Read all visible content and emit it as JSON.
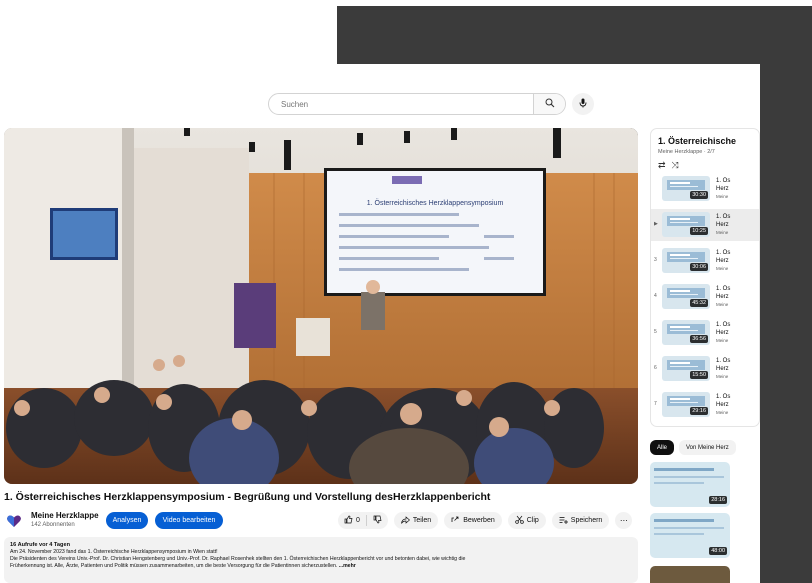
{
  "search": {
    "placeholder": "Suchen"
  },
  "video": {
    "slide_title": "1. Österreichisches Herzklappensymposium",
    "title": "1. Österreichisches Herzklappensymposium - Begrüßung und Vorstellung desHerzklappenbericht"
  },
  "channel": {
    "name": "Meine Herzklappe",
    "subscribers": "142 Abonnenten",
    "analyze_label": "Analysen",
    "edit_label": "Video bearbeiten"
  },
  "actions": {
    "like_count": "0",
    "share_label": "Teilen",
    "promote_label": "Bewerben",
    "clip_label": "Clip",
    "save_label": "Speichern"
  },
  "description": {
    "meta": "16 Aufrufe  vor 4 Tagen",
    "line1": "Am 24. November 2023 fand das 1. Österreichische Herzklappensymposium in Wien statt!",
    "line2": "Die Präsidenten des Vereins Univ.-Prof. Dr. Christian Hengstenberg und Univ.-Prof. Dr. Raphael Rosenhek stellten den 1. Österreichischen Herzklappenbericht vor und betonten dabei, wie wichtig die",
    "line3": "Früherkennung ist. Alle, Ärzte, Patienten und Politik müssen zusammenarbeiten, um die beste Versorgung für die Patientinnen sicherzustellen.",
    "more": "...mehr"
  },
  "playlist": {
    "title": "1. Österreichische",
    "subtitle": "Meine Herzklappe · 2/7",
    "items": [
      {
        "index": "",
        "title": "1. Ös",
        "title2": "Herz",
        "channel": "Meine",
        "duration": "30:30"
      },
      {
        "index": "▶",
        "title": "1. Ös",
        "title2": "Herz",
        "channel": "Meine",
        "duration": "10:25"
      },
      {
        "index": "3",
        "title": "1. Ös",
        "title2": "Herz",
        "channel": "Meine",
        "duration": "30:06"
      },
      {
        "index": "4",
        "title": "1. Ös",
        "title2": "Herz",
        "channel": "Meine",
        "duration": "45:32"
      },
      {
        "index": "5",
        "title": "1. Ös",
        "title2": "Herz",
        "channel": "Meine",
        "duration": "36:56"
      },
      {
        "index": "6",
        "title": "1. Ös",
        "title2": "Herz",
        "channel": "Meine",
        "duration": "15:50"
      },
      {
        "index": "7",
        "title": "1. Ös",
        "title2": "Herz",
        "channel": "Meine",
        "duration": "29:16"
      }
    ]
  },
  "chips": {
    "all": "Alle",
    "from_channel": "Von Meine Herz"
  },
  "recommendations": [
    {
      "duration": "28:16"
    },
    {
      "duration": "48:00"
    }
  ]
}
